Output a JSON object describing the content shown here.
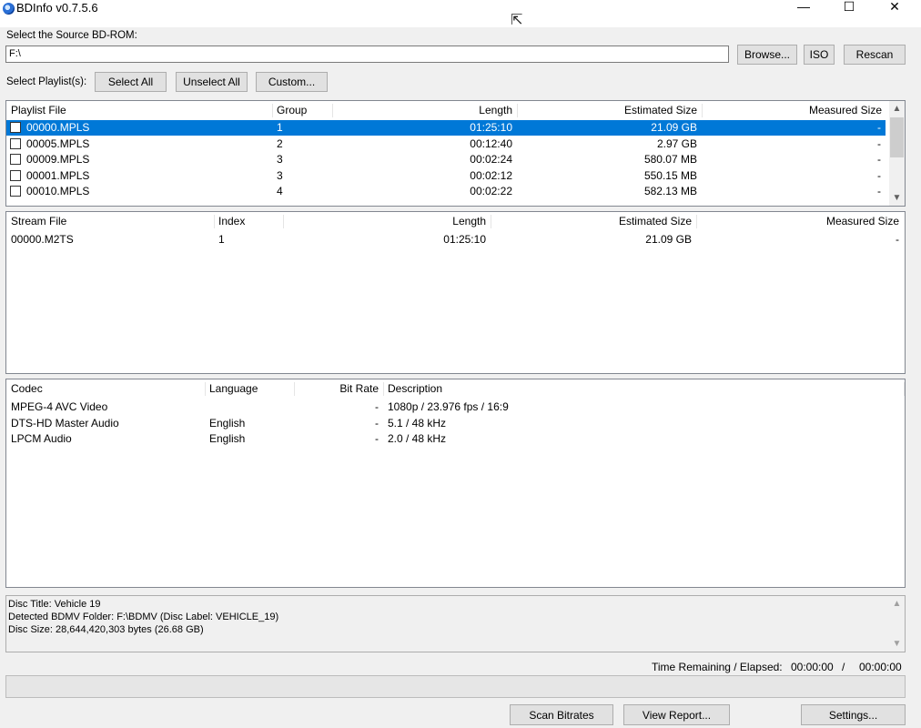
{
  "window": {
    "title": "BDInfo v0.7.5.6",
    "minimize_glyph": "—",
    "maximize_glyph": "☐",
    "close_glyph": "✕"
  },
  "source": {
    "label": "Select the Source BD-ROM:",
    "value": "F:\\",
    "browse_label": "Browse...",
    "iso_label": "ISO",
    "rescan_label": "Rescan"
  },
  "playlist_controls": {
    "label": "Select Playlist(s):",
    "select_all_label": "Select All",
    "unselect_all_label": "Unselect All",
    "custom_label": "Custom..."
  },
  "playlists": {
    "columns": [
      "Playlist File",
      "Group",
      "Length",
      "Estimated Size",
      "Measured Size"
    ],
    "rows": [
      {
        "file": "00000.MPLS",
        "group": "1",
        "length": "01:25:10",
        "est": "21.09 GB",
        "meas": "-",
        "selected": true
      },
      {
        "file": "00005.MPLS",
        "group": "2",
        "length": "00:12:40",
        "est": "2.97 GB",
        "meas": "-"
      },
      {
        "file": "00009.MPLS",
        "group": "3",
        "length": "00:02:24",
        "est": "580.07 MB",
        "meas": "-"
      },
      {
        "file": "00001.MPLS",
        "group": "3",
        "length": "00:02:12",
        "est": "550.15 MB",
        "meas": "-"
      },
      {
        "file": "00010.MPLS",
        "group": "4",
        "length": "00:02:22",
        "est": "582.13 MB",
        "meas": "-"
      }
    ]
  },
  "streams": {
    "columns": [
      "Stream File",
      "Index",
      "Length",
      "Estimated Size",
      "Measured Size"
    ],
    "rows": [
      {
        "file": "00000.M2TS",
        "index": "1",
        "length": "01:25:10",
        "est": "21.09 GB",
        "meas": "-"
      }
    ]
  },
  "codecs": {
    "columns": [
      "Codec",
      "Language",
      "Bit Rate",
      "Description"
    ],
    "rows": [
      {
        "codec": "MPEG-4 AVC Video",
        "language": "",
        "bitrate": "-",
        "description": "1080p / 23.976 fps / 16:9"
      },
      {
        "codec": "DTS-HD Master Audio",
        "language": "English",
        "bitrate": "-",
        "description": "5.1 / 48 kHz"
      },
      {
        "codec": "LPCM Audio",
        "language": "English",
        "bitrate": "-",
        "description": "2.0 / 48 kHz"
      }
    ]
  },
  "disc_info": {
    "lines": [
      "Disc Title: Vehicle 19",
      "Detected BDMV Folder: F:\\BDMV (Disc Label: VEHICLE_19)",
      "Disc Size: 28,644,420,303 bytes (26.68 GB)"
    ]
  },
  "status": {
    "time_label": "Time Remaining / Elapsed:",
    "remaining": "00:00:00",
    "separator": "/",
    "elapsed": "00:00:00",
    "progress": 0
  },
  "actions": {
    "scan_label": "Scan Bitrates",
    "report_label": "View Report...",
    "settings_label": "Settings..."
  },
  "icons": {
    "app": "bluray-disc-icon",
    "cursor": "mouse-cursor-icon",
    "up": "▲",
    "down": "▼",
    "cursor_glyph": "⇱"
  }
}
